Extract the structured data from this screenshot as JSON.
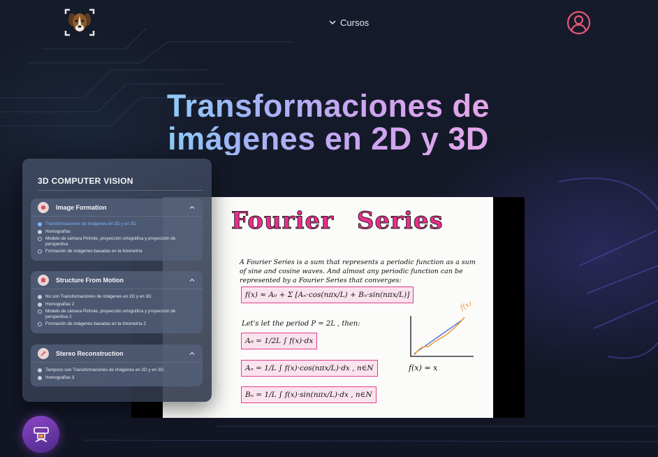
{
  "header": {
    "nav_label": "Cursos",
    "logo_icon": "dog-logo-icon",
    "user_icon": "user-profile-icon",
    "user_color": "#e8577a"
  },
  "hero": {
    "title_line1": "Transformaciones de",
    "title_line2": "imágenes en 2D y 3D"
  },
  "slide": {
    "title": "Fourier Series",
    "intro": "A Fourier Series is a sum that represents a periodic function as a sum of sine and cosine waves. And almost any periodic function can be represented by a Fourier Series that converges:",
    "let_text": "Let's let the period P = 2L , then:",
    "graph_fx": "f(x)",
    "graph_label": "f(x) = x"
  },
  "panel": {
    "title": "3D COMPUTER VISION",
    "modules": [
      {
        "name": "Image Formation",
        "icon": "brain-icon",
        "lessons": [
          "Transformaciones de imágenes en 2D y en 3D",
          "Homografías",
          "Modelo de cámara Pinhole, proyección ortográfica y proyección de perspectiva",
          "Formación de imágenes basadas en la fotometría"
        ]
      },
      {
        "name": "Structure From Motion",
        "icon": "building-icon",
        "lessons": [
          "No son Transformaciones de imágenes en 2D y en 3D",
          "Homografías 2",
          "Modelo de cámara Pinhole, proyección ortográfica y proyección de perspectiva 2",
          "Formación de imágenes basadas en la fotometría 2"
        ]
      },
      {
        "name": "Stereo Reconstruction",
        "icon": "stereo-icon",
        "lessons": [
          "Tampoco son Transformaciones de imágenes en 2D y en 3D",
          "Homografías 3"
        ]
      }
    ]
  },
  "fab": {
    "icon": "vr-headset-icon"
  }
}
